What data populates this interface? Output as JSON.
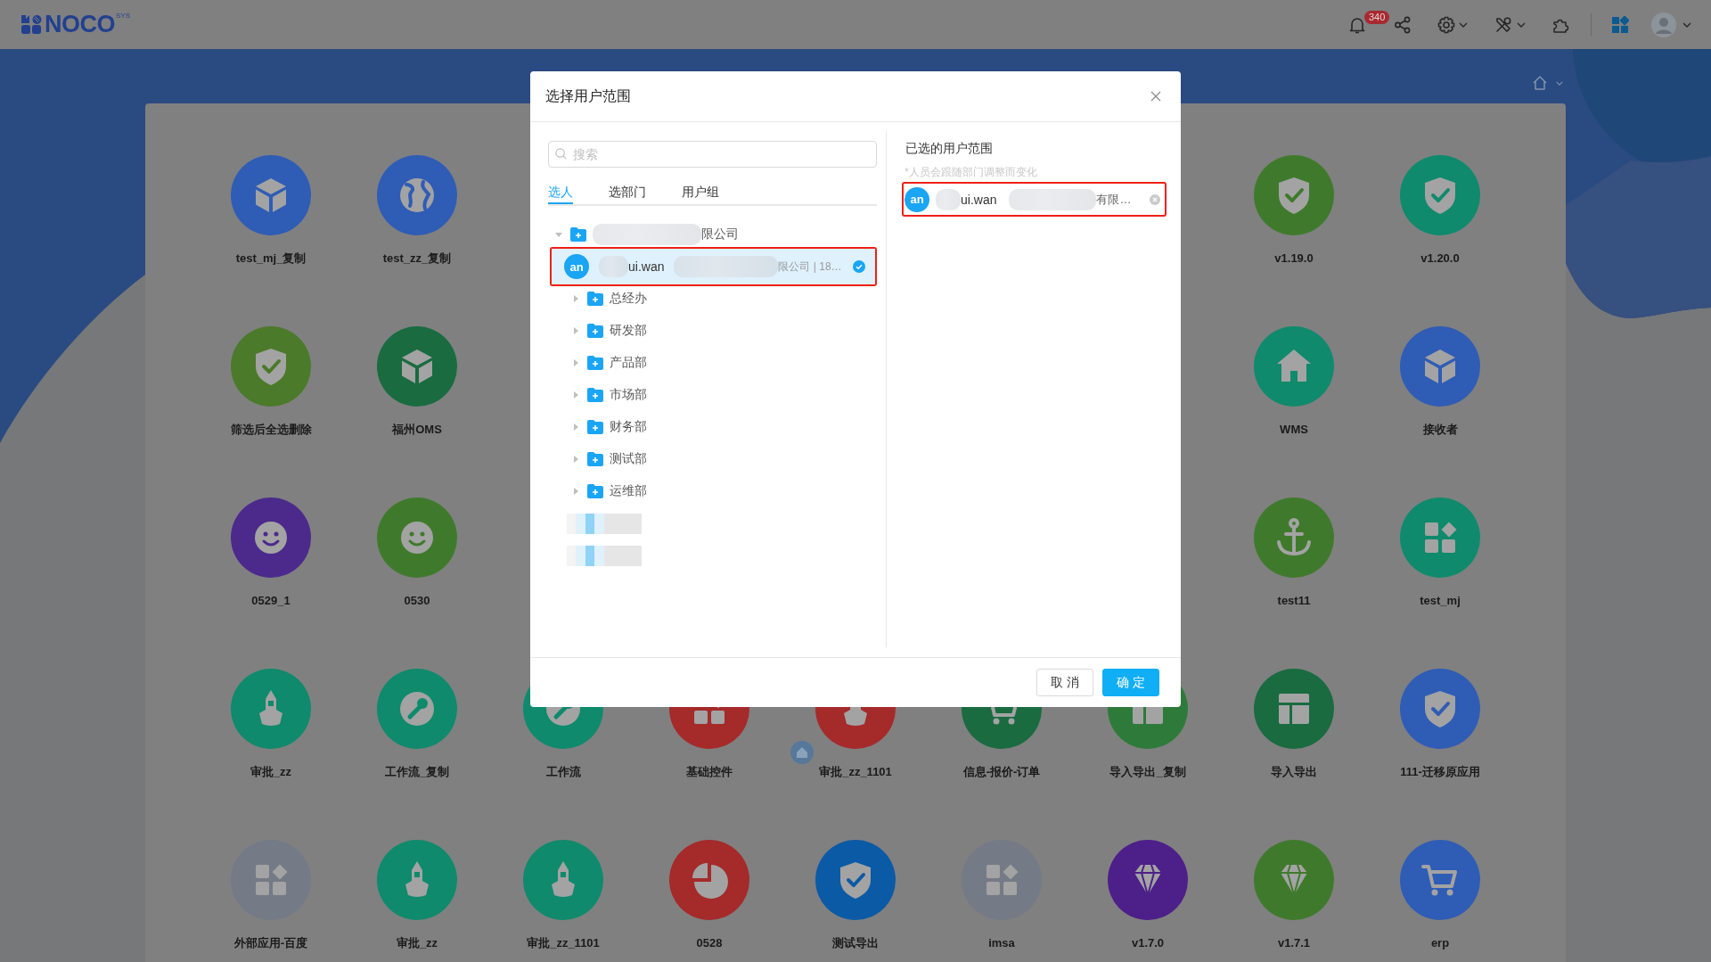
{
  "top_bar": {
    "logo_text": "NOCO",
    "logo_sup": "SYS",
    "notification_count": "340"
  },
  "app_rows": [
    [
      {
        "kind": "cube",
        "label": "test_mj_复制",
        "color": "#2f5cb5"
      },
      {
        "kind": "globe",
        "label": "test_zz_复制",
        "color": "#2f5cb5"
      },
      {
        "kind": "covered"
      },
      {
        "kind": "covered"
      },
      {
        "kind": "covered"
      },
      {
        "kind": "covered"
      },
      {
        "kind": "covered"
      },
      {
        "kind": "shield",
        "label": "v1.19.0",
        "color": "#3f7a2c"
      },
      {
        "kind": "shield",
        "label": "v1.20.0",
        "color": "#0f8a6c"
      }
    ],
    [
      {
        "kind": "shield",
        "label": "筛选后全选删除",
        "color": "#4a7a2a"
      },
      {
        "kind": "cube",
        "label": "福州OMS",
        "color": "#1a6b40"
      },
      {
        "kind": "covered"
      },
      {
        "kind": "covered"
      },
      {
        "kind": "covered"
      },
      {
        "kind": "covered"
      },
      {
        "kind": "covered"
      },
      {
        "kind": "house",
        "label": "WMS",
        "color": "#0f8a6c"
      },
      {
        "kind": "cube",
        "label": "接收者",
        "color": "#2f5cb5"
      }
    ],
    [
      {
        "kind": "smile",
        "label": "0529_1",
        "color": "#4b2a8c"
      },
      {
        "kind": "smile",
        "label": "0530",
        "color": "#3f7a2c"
      },
      {
        "kind": "covered"
      },
      {
        "kind": "covered"
      },
      {
        "kind": "covered"
      },
      {
        "kind": "covered"
      },
      {
        "kind": "covered"
      },
      {
        "kind": "anchor",
        "label": "test11",
        "color": "#3f7a2c"
      },
      {
        "kind": "tiles",
        "label": "test_mj",
        "color": "#0f8a6c"
      }
    ],
    [
      {
        "kind": "boat",
        "label": "审批_zz",
        "color": "#0f8a6c"
      },
      {
        "kind": "wrench",
        "label": "工作流_复制",
        "color": "#0f8a6c"
      },
      {
        "kind": "wrench",
        "label": "工作流",
        "color": "#0f8a6c"
      },
      {
        "kind": "tiles",
        "label": "基础控件",
        "color": "#a52a2a"
      },
      {
        "kind": "boat",
        "label": "审批_zz_1101",
        "color": "#a52a2a"
      },
      {
        "kind": "cart",
        "label": "信息-报价-订单",
        "color": "#1a6b40"
      },
      {
        "kind": "layout",
        "label": "导入导出_复制",
        "color": "#2e7a3a"
      },
      {
        "kind": "layout",
        "label": "导入导出",
        "color": "#1a6b40"
      },
      {
        "kind": "shield",
        "label": "111-迁移原应用",
        "color": "#2f5cb5"
      }
    ],
    [
      {
        "kind": "tiles",
        "label": "外部应用-百度",
        "color": "#747a86"
      },
      {
        "kind": "boat",
        "label": "审批_zz",
        "color": "#0f8a6c"
      },
      {
        "kind": "boat",
        "label": "审批_zz_1101",
        "color": "#0f8a6c"
      },
      {
        "kind": "pie",
        "label": "0528",
        "color": "#a52a2a"
      },
      {
        "kind": "shield",
        "label": "测试导出",
        "color": "#0b5aa5"
      },
      {
        "kind": "tiles",
        "label": "imsa",
        "color": "#747a86"
      },
      {
        "kind": "diamond",
        "label": "v1.7.0",
        "color": "#4d1f88"
      },
      {
        "kind": "diamond",
        "label": "v1.7.1",
        "color": "#3f7a2c"
      },
      {
        "kind": "cart",
        "label": "erp",
        "color": "#2f5cb5"
      }
    ]
  ],
  "dialog": {
    "title": "选择用户范围",
    "search": {
      "placeholder": "搜索"
    },
    "tabs": [
      {
        "label": "选人",
        "selected": true
      },
      {
        "label": "选部门",
        "selected": false
      },
      {
        "label": "用户组",
        "selected": false
      }
    ],
    "tree": [
      {
        "kind": "dept",
        "label": "限公司",
        "redacted": true,
        "expanded": true,
        "children": [
          {
            "kind": "user",
            "avatar": "an",
            "name": "ui.wan",
            "detail": "限公司 | 18…",
            "redacted": true,
            "selected": true,
            "highlighted": true
          },
          {
            "kind": "dept",
            "label": "总经办",
            "expanded": false
          },
          {
            "kind": "dept",
            "label": "研发部",
            "expanded": false
          },
          {
            "kind": "dept",
            "label": "产品部",
            "expanded": false
          },
          {
            "kind": "dept",
            "label": "市场部",
            "expanded": false
          },
          {
            "kind": "dept",
            "label": "财务部",
            "expanded": false
          },
          {
            "kind": "dept",
            "label": "测试部",
            "expanded": false
          },
          {
            "kind": "dept",
            "label": "运维部",
            "expanded": false
          }
        ]
      },
      {
        "kind": "redacted"
      },
      {
        "kind": "redacted"
      }
    ],
    "selected_panel": {
      "title": "已选的用户范围",
      "hint": "*人员会跟随部门调整而变化",
      "items": [
        {
          "avatar": "an",
          "name": "ui.wan",
          "detail": "有限…",
          "redacted": true,
          "highlighted": true
        }
      ]
    },
    "buttons": [
      {
        "kind": "default",
        "label": "取 消"
      },
      {
        "kind": "primary",
        "label": "确 定"
      }
    ]
  }
}
